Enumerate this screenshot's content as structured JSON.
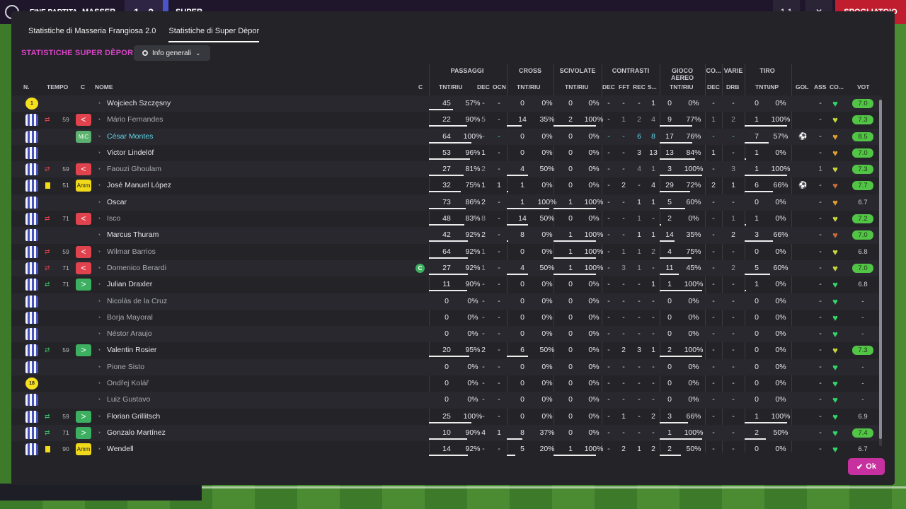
{
  "topbar": {
    "label": "FINE PARTITA",
    "home_team": "MASSER",
    "score": "1 - 2",
    "away_team": "SUPER",
    "box_label": "1 1",
    "close": "✕",
    "right_button": "SPOGLIATOIO"
  },
  "tabs": [
    {
      "label": "Statistiche di Masseria Frangiosa 2.0"
    },
    {
      "label": "Statistiche di Super Dèpor"
    }
  ],
  "section_title": "STATISTICHE SUPER DÈPOR",
  "view_dropdown": {
    "label": "Info generali"
  },
  "groups": {
    "passaggi": "PASSAGGI",
    "cross": "CROSS",
    "scivolate": "SCIVOLATE",
    "contrasti": "CONTRASTI",
    "aereo": "GIOCO AEREO",
    "co": "CO...",
    "varie": "VARIE",
    "tiro": "TIRO"
  },
  "columns": {
    "n": "N.",
    "tempo": "TEMPO",
    "c": "C",
    "nome": "NOME",
    "c2": "C",
    "pas_tr": "TNT/RIU",
    "pas_dec": "DEC",
    "pas_ocn": "OCN",
    "cro_tr": "TNT/RIU",
    "sci_tr": "TNT/RIU",
    "con_dec": "DEC",
    "con_fft": "FFT",
    "con_rec": "REC",
    "con_s": "S...",
    "aer_tr": "TNT/RIU",
    "co_dec": "DEC",
    "var_drb": "DRB",
    "tir_tr": "TNT\\INP",
    "gol": "GOL",
    "ass": "ASS",
    "cond": "CO...",
    "vot": "VOT"
  },
  "ok_label": "Ok",
  "players": [
    {
      "kit": "gk",
      "kitno": "1",
      "sub": "",
      "min": "",
      "pos": "",
      "name": "Wojciech Szczęsny",
      "ns": "",
      "cap": "",
      "pa": "45",
      "pp": "57%",
      "pd": "-",
      "po": "-",
      "ca": "0",
      "cp": "0%",
      "sa": "0",
      "sp": "0%",
      "kd": "-",
      "kf": "-",
      "kr": "-",
      "ks": "1",
      "aa": "0",
      "ap": "0%",
      "cd": "-",
      "vd": "-",
      "ta": "0",
      "tp": "0%",
      "gol": "",
      "ass": "-",
      "heart": "g",
      "vot": "7.0",
      "vh": "hi",
      "dim": []
    },
    {
      "kit": "",
      "kitno": "",
      "sub": "off",
      "min": "59",
      "pos": "red",
      "name": "Mário Fernandes",
      "ns": "dim",
      "cap": "",
      "pa": "22",
      "pp": "90%",
      "pd": "5",
      "po": "-",
      "ca": "14",
      "cp": "35%",
      "sa": "2",
      "sp": "100%",
      "kd": "-",
      "kf": "1",
      "kr": "2",
      "ks": "4",
      "aa": "9",
      "ap": "77%",
      "cd": "1",
      "vd": "2",
      "ta": "1",
      "tp": "100%",
      "gol": "",
      "ass": "-",
      "heart": "y",
      "vot": "7.3",
      "vh": "hi",
      "dim": [
        "pd",
        "kf",
        "kr",
        "ks",
        "cd",
        "vd"
      ]
    },
    {
      "kit": "",
      "kitno": "",
      "sub": "",
      "min": "",
      "pos": "mic",
      "name": "César Montes",
      "ns": "cyan",
      "cap": "",
      "pa": "64",
      "pp": "100%",
      "pd": "-",
      "po": "-",
      "ca": "0",
      "cp": "0%",
      "sa": "0",
      "sp": "0%",
      "kd": "-",
      "kf": "-",
      "kr": "6",
      "ks": "8",
      "aa": "17",
      "ap": "76%",
      "cd": "-",
      "vd": "-",
      "ta": "7",
      "tp": "57%",
      "gol": "⚽",
      "ass": "-",
      "heart": "o",
      "vot": "8.5",
      "vh": "hi",
      "dim": [],
      "cyan": [
        "kr",
        "ks",
        "pd",
        "po",
        "kd",
        "kf",
        "cd",
        "vd"
      ]
    },
    {
      "kit": "",
      "kitno": "",
      "sub": "",
      "min": "",
      "pos": "",
      "name": "Victor Lindelöf",
      "ns": "",
      "cap": "",
      "pa": "53",
      "pp": "96%",
      "pd": "1",
      "po": "-",
      "ca": "0",
      "cp": "0%",
      "sa": "0",
      "sp": "0%",
      "kd": "-",
      "kf": "-",
      "kr": "3",
      "ks": "13",
      "aa": "13",
      "ap": "84%",
      "cd": "1",
      "vd": "-",
      "ta": "1",
      "tp": "0%",
      "gol": "",
      "ass": "-",
      "heart": "o",
      "vot": "7.0",
      "vh": "hi",
      "dim": []
    },
    {
      "kit": "",
      "kitno": "",
      "sub": "off",
      "min": "59",
      "pos": "red",
      "name": "Faouzi Ghoulam",
      "ns": "dim",
      "cap": "",
      "pa": "27",
      "pp": "81%",
      "pd": "2",
      "po": "-",
      "ca": "4",
      "cp": "50%",
      "sa": "0",
      "sp": "0%",
      "kd": "-",
      "kf": "-",
      "kr": "4",
      "ks": "1",
      "aa": "3",
      "ap": "100%",
      "cd": "-",
      "vd": "3",
      "ta": "1",
      "tp": "100%",
      "gol": "",
      "ass": "1",
      "heart": "y",
      "vot": "7.3",
      "vh": "hi",
      "dim": [
        "pd",
        "kr",
        "ks",
        "vd",
        "ass"
      ]
    },
    {
      "kit": "",
      "kitno": "",
      "sub": "card",
      "min": "51",
      "pos": "amm",
      "name": "José Manuel López",
      "ns": "",
      "cap": "",
      "pa": "32",
      "pp": "75%",
      "pd": "1",
      "po": "1",
      "ca": "1",
      "cp": "0%",
      "sa": "0",
      "sp": "0%",
      "kd": "-",
      "kf": "2",
      "kr": "-",
      "ks": "4",
      "aa": "29",
      "ap": "72%",
      "cd": "2",
      "vd": "1",
      "ta": "6",
      "tp": "66%",
      "gol": "⚽",
      "ass": "-",
      "heart": "b",
      "vot": "7.7",
      "vh": "hi",
      "dim": []
    },
    {
      "kit": "",
      "kitno": "",
      "sub": "",
      "min": "",
      "pos": "",
      "name": "Oscar",
      "ns": "",
      "cap": "",
      "pa": "73",
      "pp": "86%",
      "pd": "2",
      "po": "-",
      "ca": "1",
      "cp": "100%",
      "sa": "1",
      "sp": "100%",
      "kd": "-",
      "kf": "-",
      "kr": "1",
      "ks": "1",
      "aa": "5",
      "ap": "60%",
      "cd": "-",
      "vd": "-",
      "ta": "0",
      "tp": "0%",
      "gol": "",
      "ass": "-",
      "heart": "o",
      "vot": "6.7",
      "vh": "lo",
      "dim": []
    },
    {
      "kit": "",
      "kitno": "",
      "sub": "off",
      "min": "71",
      "pos": "red",
      "name": "Isco",
      "ns": "dim",
      "cap": "",
      "pa": "48",
      "pp": "83%",
      "pd": "8",
      "po": "-",
      "ca": "14",
      "cp": "50%",
      "sa": "0",
      "sp": "0%",
      "kd": "-",
      "kf": "-",
      "kr": "1",
      "ks": "-",
      "aa": "2",
      "ap": "0%",
      "cd": "-",
      "vd": "1",
      "ta": "1",
      "tp": "0%",
      "gol": "",
      "ass": "-",
      "heart": "y",
      "vot": "7.2",
      "vh": "hi",
      "dim": [
        "pd",
        "kr",
        "vd"
      ]
    },
    {
      "kit": "",
      "kitno": "",
      "sub": "",
      "min": "",
      "pos": "",
      "name": "Marcus Thuram",
      "ns": "",
      "cap": "",
      "pa": "42",
      "pp": "92%",
      "pd": "2",
      "po": "-",
      "ca": "8",
      "cp": "0%",
      "sa": "1",
      "sp": "100%",
      "kd": "-",
      "kf": "-",
      "kr": "1",
      "ks": "1",
      "aa": "14",
      "ap": "35%",
      "cd": "-",
      "vd": "2",
      "ta": "3",
      "tp": "66%",
      "gol": "",
      "ass": "-",
      "heart": "b",
      "vot": "7.0",
      "vh": "hi",
      "dim": []
    },
    {
      "kit": "",
      "kitno": "",
      "sub": "off",
      "min": "59",
      "pos": "red",
      "name": "Wilmar Barrios",
      "ns": "dim",
      "cap": "",
      "pa": "64",
      "pp": "92%",
      "pd": "1",
      "po": "-",
      "ca": "0",
      "cp": "0%",
      "sa": "1",
      "sp": "100%",
      "kd": "-",
      "kf": "1",
      "kr": "1",
      "ks": "2",
      "aa": "4",
      "ap": "75%",
      "cd": "-",
      "vd": "-",
      "ta": "0",
      "tp": "0%",
      "gol": "",
      "ass": "-",
      "heart": "y",
      "vot": "6.8",
      "vh": "lo",
      "dim": [
        "pd",
        "kf",
        "kr",
        "ks"
      ]
    },
    {
      "kit": "",
      "kitno": "",
      "sub": "off",
      "min": "71",
      "pos": "red",
      "name": "Domenico Berardi",
      "ns": "dim",
      "cap": "C",
      "pa": "27",
      "pp": "92%",
      "pd": "1",
      "po": "-",
      "ca": "4",
      "cp": "50%",
      "sa": "1",
      "sp": "100%",
      "kd": "-",
      "kf": "3",
      "kr": "1",
      "ks": "-",
      "aa": "11",
      "ap": "45%",
      "cd": "-",
      "vd": "2",
      "ta": "5",
      "tp": "60%",
      "gol": "",
      "ass": "-",
      "heart": "y",
      "vot": "7.0",
      "vh": "hi",
      "dim": [
        "pd",
        "kf",
        "kr",
        "vd"
      ]
    },
    {
      "kit": "",
      "kitno": "",
      "sub": "on",
      "min": "71",
      "pos": "grn",
      "name": "Julian Draxler",
      "ns": "",
      "cap": "",
      "pa": "11",
      "pp": "90%",
      "pd": "-",
      "po": "-",
      "ca": "0",
      "cp": "0%",
      "sa": "0",
      "sp": "0%",
      "kd": "-",
      "kf": "-",
      "kr": "-",
      "ks": "1",
      "aa": "1",
      "ap": "100%",
      "cd": "-",
      "vd": "-",
      "ta": "1",
      "tp": "0%",
      "gol": "",
      "ass": "-",
      "heart": "g",
      "vot": "6.8",
      "vh": "lo",
      "dim": []
    },
    {
      "kit": "",
      "kitno": "",
      "sub": "",
      "min": "",
      "pos": "",
      "name": "Nicolás de la Cruz",
      "ns": "dim",
      "cap": "",
      "pa": "0",
      "pp": "0%",
      "pd": "-",
      "po": "-",
      "ca": "0",
      "cp": "0%",
      "sa": "0",
      "sp": "0%",
      "kd": "-",
      "kf": "-",
      "kr": "-",
      "ks": "-",
      "aa": "0",
      "ap": "0%",
      "cd": "-",
      "vd": "-",
      "ta": "0",
      "tp": "0%",
      "gol": "",
      "ass": "-",
      "heart": "g",
      "vot": "-",
      "vh": "lo",
      "dim": []
    },
    {
      "kit": "",
      "kitno": "",
      "sub": "",
      "min": "",
      "pos": "",
      "name": "Borja Mayoral",
      "ns": "dim",
      "cap": "",
      "pa": "0",
      "pp": "0%",
      "pd": "-",
      "po": "-",
      "ca": "0",
      "cp": "0%",
      "sa": "0",
      "sp": "0%",
      "kd": "-",
      "kf": "-",
      "kr": "-",
      "ks": "-",
      "aa": "0",
      "ap": "0%",
      "cd": "-",
      "vd": "-",
      "ta": "0",
      "tp": "0%",
      "gol": "",
      "ass": "-",
      "heart": "g",
      "vot": "-",
      "vh": "lo",
      "dim": []
    },
    {
      "kit": "",
      "kitno": "",
      "sub": "",
      "min": "",
      "pos": "",
      "name": "Néstor Araujo",
      "ns": "dim",
      "cap": "",
      "pa": "0",
      "pp": "0%",
      "pd": "-",
      "po": "-",
      "ca": "0",
      "cp": "0%",
      "sa": "0",
      "sp": "0%",
      "kd": "-",
      "kf": "-",
      "kr": "-",
      "ks": "-",
      "aa": "0",
      "ap": "0%",
      "cd": "-",
      "vd": "-",
      "ta": "0",
      "tp": "0%",
      "gol": "",
      "ass": "-",
      "heart": "g",
      "vot": "-",
      "vh": "lo",
      "dim": []
    },
    {
      "kit": "",
      "kitno": "",
      "sub": "on",
      "min": "59",
      "pos": "grn",
      "name": "Valentin Rosier",
      "ns": "",
      "cap": "",
      "pa": "20",
      "pp": "95%",
      "pd": "2",
      "po": "-",
      "ca": "6",
      "cp": "50%",
      "sa": "0",
      "sp": "0%",
      "kd": "-",
      "kf": "2",
      "kr": "3",
      "ks": "1",
      "aa": "2",
      "ap": "100%",
      "cd": "-",
      "vd": "-",
      "ta": "0",
      "tp": "0%",
      "gol": "",
      "ass": "-",
      "heart": "y",
      "vot": "7.3",
      "vh": "hi",
      "dim": []
    },
    {
      "kit": "",
      "kitno": "",
      "sub": "",
      "min": "",
      "pos": "",
      "name": "Pione Sisto",
      "ns": "dim",
      "cap": "",
      "pa": "0",
      "pp": "0%",
      "pd": "-",
      "po": "-",
      "ca": "0",
      "cp": "0%",
      "sa": "0",
      "sp": "0%",
      "kd": "-",
      "kf": "-",
      "kr": "-",
      "ks": "-",
      "aa": "0",
      "ap": "0%",
      "cd": "-",
      "vd": "-",
      "ta": "0",
      "tp": "0%",
      "gol": "",
      "ass": "-",
      "heart": "g",
      "vot": "-",
      "vh": "lo",
      "dim": []
    },
    {
      "kit": "gk",
      "kitno": "18",
      "sub": "",
      "min": "",
      "pos": "",
      "name": "Ondřej Kolář",
      "ns": "dim",
      "cap": "",
      "pa": "0",
      "pp": "0%",
      "pd": "-",
      "po": "-",
      "ca": "0",
      "cp": "0%",
      "sa": "0",
      "sp": "0%",
      "kd": "-",
      "kf": "-",
      "kr": "-",
      "ks": "-",
      "aa": "0",
      "ap": "0%",
      "cd": "-",
      "vd": "-",
      "ta": "0",
      "tp": "0%",
      "gol": "",
      "ass": "-",
      "heart": "g",
      "vot": "-",
      "vh": "lo",
      "dim": []
    },
    {
      "kit": "",
      "kitno": "",
      "sub": "",
      "min": "",
      "pos": "",
      "name": "Luiz Gustavo",
      "ns": "dim",
      "cap": "",
      "pa": "0",
      "pp": "0%",
      "pd": "-",
      "po": "-",
      "ca": "0",
      "cp": "0%",
      "sa": "0",
      "sp": "0%",
      "kd": "-",
      "kf": "-",
      "kr": "-",
      "ks": "-",
      "aa": "0",
      "ap": "0%",
      "cd": "-",
      "vd": "-",
      "ta": "0",
      "tp": "0%",
      "gol": "",
      "ass": "-",
      "heart": "g",
      "vot": "-",
      "vh": "lo",
      "dim": []
    },
    {
      "kit": "",
      "kitno": "",
      "sub": "on",
      "min": "59",
      "pos": "grn",
      "name": "Florian Grillitsch",
      "ns": "",
      "cap": "",
      "pa": "25",
      "pp": "100%",
      "pd": "-",
      "po": "-",
      "ca": "0",
      "cp": "0%",
      "sa": "0",
      "sp": "0%",
      "kd": "-",
      "kf": "1",
      "kr": "-",
      "ks": "2",
      "aa": "3",
      "ap": "66%",
      "cd": "-",
      "vd": "-",
      "ta": "1",
      "tp": "100%",
      "gol": "",
      "ass": "-",
      "heart": "g",
      "vot": "6.9",
      "vh": "lo",
      "dim": []
    },
    {
      "kit": "",
      "kitno": "",
      "sub": "on",
      "min": "71",
      "pos": "grn",
      "name": "Gonzalo Martínez",
      "ns": "",
      "cap": "",
      "pa": "10",
      "pp": "90%",
      "pd": "4",
      "po": "1",
      "ca": "8",
      "cp": "37%",
      "sa": "0",
      "sp": "0%",
      "kd": "-",
      "kf": "-",
      "kr": "-",
      "ks": "-",
      "aa": "1",
      "ap": "100%",
      "cd": "-",
      "vd": "-",
      "ta": "2",
      "tp": "50%",
      "gol": "",
      "ass": "-",
      "heart": "g",
      "vot": "7.4",
      "vh": "hi",
      "dim": []
    },
    {
      "kit": "",
      "kitno": "",
      "sub": "card",
      "min": "90",
      "pos": "amm",
      "name": "Wendell",
      "ns": "",
      "cap": "",
      "pa": "14",
      "pp": "92%",
      "pd": "-",
      "po": "-",
      "ca": "5",
      "cp": "20%",
      "sa": "1",
      "sp": "100%",
      "kd": "-",
      "kf": "2",
      "kr": "1",
      "ks": "2",
      "aa": "2",
      "ap": "50%",
      "cd": "-",
      "vd": "-",
      "ta": "0",
      "tp": "0%",
      "gol": "",
      "ass": "-",
      "heart": "g",
      "vot": "6.7",
      "vh": "lo",
      "dim": []
    }
  ],
  "pos_labels": {
    "mic": "MiC",
    "amm": "Amm",
    "red": "<",
    "grn": ">"
  }
}
